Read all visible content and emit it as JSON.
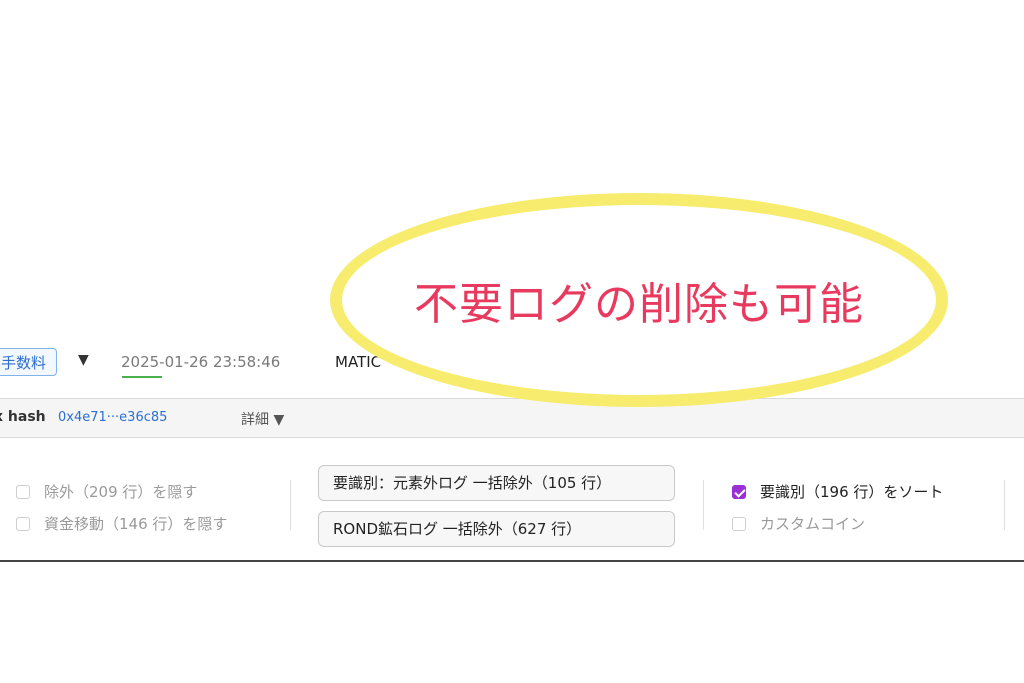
{
  "transaction": {
    "fee_badge": "手数料",
    "caret": "▼",
    "timestamp": "2025-01-26 23:58:46",
    "token": "MATIC"
  },
  "hash_row": {
    "label": "x hash",
    "value": "0x4e71···e36c85",
    "detail": "詳細 ▼"
  },
  "filters": {
    "hide_excluded": {
      "label": "除外（209 行）を隠す",
      "checked": false
    },
    "hide_transfers": {
      "label": "資金移動（146 行）を隠す",
      "checked": false
    }
  },
  "actions": {
    "exclude_non_element": "要識別：元素外ログ 一括除外（105 行）",
    "exclude_rond_ore": "ROND鉱石ログ 一括除外（627 行）"
  },
  "sort_options": {
    "sort_unidentified": {
      "label": "要識別（196 行）をソート",
      "checked": true
    },
    "custom_coin": {
      "label": "カスタムコイン",
      "checked": false
    }
  },
  "callout": {
    "text": "不要ログの削除も可能",
    "border_color": "#f7ec6e",
    "text_color": "#e83a5e"
  },
  "colors": {
    "accent_blue": "#2c6fd1",
    "checkbox_purple": "#9b2fd6"
  }
}
